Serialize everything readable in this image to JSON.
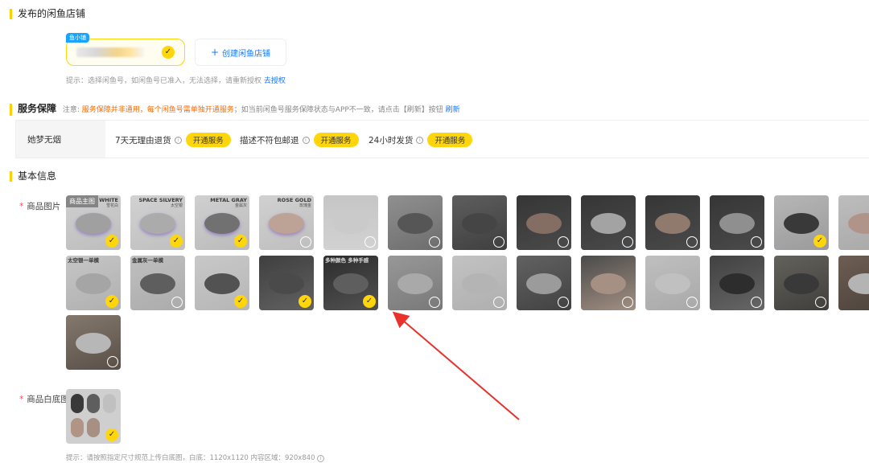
{
  "sections": {
    "shops_title": "发布的闲鱼店铺",
    "service_title": "服务保障",
    "basic_title": "基本信息"
  },
  "shop": {
    "tag": "鱼小铺",
    "create_label": "创建闲鱼店铺",
    "hint_text": "提示：选择闲鱼号，如闲鱼号已准入，无法选择，请重新授权",
    "hint_link": "去授权"
  },
  "service": {
    "note_prefix": "注意:",
    "note_warn": "服务保障并非通用，每个闲鱼号需单独开通服务",
    "note_rest": "；如当前闲鱼号服务保障状态与APP不一致，请点击【刷新】按钮",
    "note_link": "刷新",
    "shop_name": "她梦无烟",
    "items": [
      {
        "label": "7天无理由退货",
        "button": "开通服务"
      },
      {
        "label": "描述不符包邮退",
        "button": "开通服务"
      },
      {
        "label": "24小时发货",
        "button": "开通服务"
      }
    ]
  },
  "basic": {
    "images_label": "商品图片",
    "white_label": "商品白底图",
    "main_image_tag": "商品主图",
    "thumbs": [
      {
        "cap": "WHITE",
        "sub": "雪花白",
        "selected": true
      },
      {
        "cap": "SPACE SILVERY",
        "sub": "太空银",
        "selected": true
      },
      {
        "cap": "METAL GRAY",
        "sub": "金属灰",
        "selected": true
      },
      {
        "cap": "ROSE GOLD",
        "sub": "玫瑰金",
        "selected": false
      },
      {
        "cap": "",
        "sub": "",
        "selected": false
      },
      {
        "cap": "",
        "sub": "",
        "selected": false
      },
      {
        "cap": "",
        "sub": "",
        "selected": false
      },
      {
        "cap": "",
        "sub": "",
        "selected": false
      },
      {
        "cap": "",
        "sub": "",
        "selected": false
      },
      {
        "cap": "",
        "sub": "",
        "selected": false
      },
      {
        "cap": "",
        "sub": "",
        "selected": false
      },
      {
        "cap": "",
        "sub": "",
        "selected": true
      },
      {
        "cap": "",
        "sub": "",
        "selected": false
      },
      {
        "cap": "太空银一单模",
        "sub": "",
        "selected": true
      },
      {
        "cap": "金属灰一单模",
        "sub": "",
        "selected": false
      },
      {
        "cap": "",
        "sub": "",
        "selected": true
      },
      {
        "cap": "",
        "sub": "",
        "selected": true
      },
      {
        "cap": "多种颜色 多种手感",
        "sub": "",
        "selected": true
      },
      {
        "cap": "",
        "sub": "",
        "selected": false
      },
      {
        "cap": "",
        "sub": "",
        "selected": false
      },
      {
        "cap": "",
        "sub": "",
        "selected": false
      },
      {
        "cap": "",
        "sub": "",
        "selected": false
      },
      {
        "cap": "",
        "sub": "",
        "selected": false
      },
      {
        "cap": "",
        "sub": "",
        "selected": false
      },
      {
        "cap": "",
        "sub": "",
        "selected": false
      },
      {
        "cap": "",
        "sub": "",
        "selected": false
      },
      {
        "cap": "",
        "sub": "",
        "selected": false
      }
    ],
    "white_thumb_selected": true,
    "white_hint": "提示：请按照指定尺寸规范上传白底图，白底：1120x1120 内容区域：920x840"
  },
  "colors": {
    "accent": "#ffd60a",
    "link": "#1677ff",
    "warn": "#ff6a00",
    "required": "#ff4d4f",
    "arrow": "#e8322b"
  }
}
